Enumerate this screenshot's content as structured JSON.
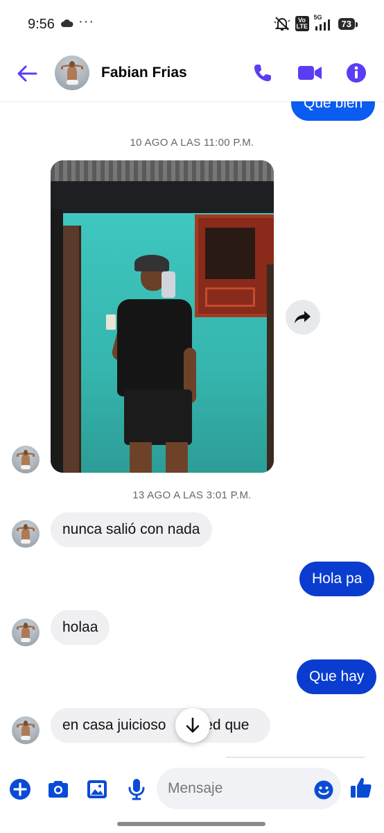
{
  "status_bar": {
    "time": "9:56",
    "overflow": "···",
    "volte": "Vo LTE",
    "network": "5G",
    "battery": "73"
  },
  "header": {
    "contact_name": "Fabian Frias",
    "icons": [
      "back-arrow-icon",
      "phone-icon",
      "video-camera-icon",
      "info-icon"
    ],
    "accent_color": "#5b3df5"
  },
  "messages": {
    "top_outgoing": "Que bien",
    "timestamp_1": "10 AGO A LAS 11:00 P.M.",
    "timestamp_2": "13 AGO A LAS 3:01 P.M.",
    "in_1": "nunca salió con nada",
    "out_1": "Hola pa",
    "in_2": "holaa",
    "out_2": "Que hay",
    "in_3_part_a": "en casa juicioso",
    "in_3_part_b": "ted que"
  },
  "composer": {
    "placeholder": "Mensaje",
    "icons": [
      "plus-icon",
      "camera-icon",
      "gallery-icon",
      "microphone-icon",
      "emoji-icon",
      "thumbs-up-icon"
    ]
  },
  "colors": {
    "outgoing_bubble": "#0a3cd0",
    "incoming_bubble": "#f0f0f2",
    "icon_purple": "#5b3df5",
    "composer_icon_blue": "#0a4bd6"
  }
}
